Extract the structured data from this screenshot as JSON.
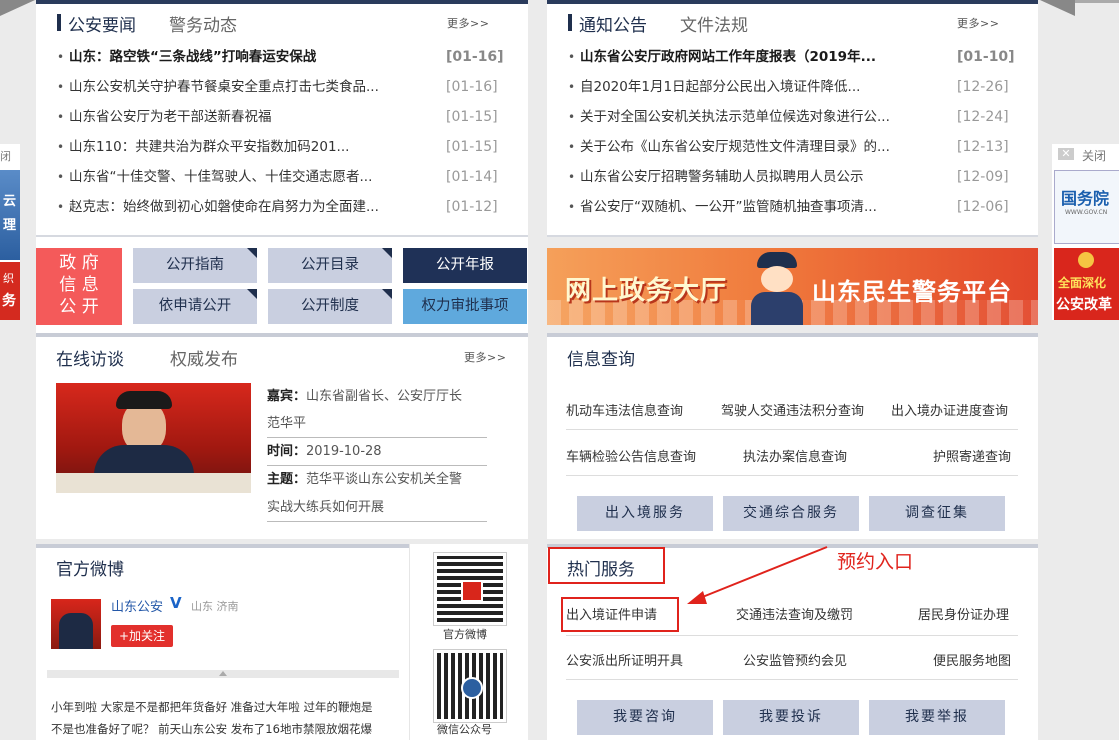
{
  "news_panel": {
    "tab_active": "公安要闻",
    "tab_other": "警务动态",
    "more": "更多>>",
    "items": [
      {
        "title": "山东：路空铁“三条战线”打响春运安保战",
        "date": "[01-16]"
      },
      {
        "title": "山东公安机关守护春节餐桌安全重点打击七类食品...",
        "date": "[01-16]"
      },
      {
        "title": "山东省公安厅为老干部送新春祝福",
        "date": "[01-15]"
      },
      {
        "title": "山东110：共建共治为群众平安指数加码201...",
        "date": "[01-15]"
      },
      {
        "title": "山东省“十佳交警、十佳驾驶人、十佳交通志愿者...",
        "date": "[01-14]"
      },
      {
        "title": "赵克志：始终做到初心如磐使命在肩努力为全面建...",
        "date": "[01-12]"
      }
    ]
  },
  "notice_panel": {
    "tab_active": "通知公告",
    "tab_other": "文件法规",
    "more": "更多>>",
    "items": [
      {
        "title": "山东省公安厅政府网站工作年度报表（2019年...",
        "date": "[01-10]"
      },
      {
        "title": "自2020年1月1日起部分公民出入境证件降低...",
        "date": "[12-26]"
      },
      {
        "title": "关于对全国公安机关执法示范单位候选对象进行公...",
        "date": "[12-24]"
      },
      {
        "title": "关于公布《山东省公安厅规范性文件清理目录》的...",
        "date": "[12-13]"
      },
      {
        "title": "山东省公安厅招聘警务辅助人员拟聘用人员公示",
        "date": "[12-09]"
      },
      {
        "title": "省公安厅“双随机、一公开”监管随机抽查事项清...",
        "date": "[12-06]"
      }
    ]
  },
  "gov_info": {
    "label_lines": [
      "政 府",
      "信 息",
      "公 开"
    ],
    "buttons": [
      "公开指南",
      "公开目录",
      "公开年报",
      "依申请公开",
      "公开制度",
      "权力审批事项"
    ]
  },
  "banner": {
    "left_text": "网上政务大厅",
    "right_text": "山东民生警务平台"
  },
  "interview": {
    "tab_active": "在线访谈",
    "tab_other": "权威发布",
    "more": "更多>>",
    "guest_label": "嘉宾：",
    "guest_value": "山东省副省长、公安厅厅长",
    "guest_name": "范华平",
    "time_label": "时间：",
    "time_value": "2019-10-28",
    "topic_label": "主题：",
    "topic_value": "范华平谈山东公安机关全警",
    "topic_value2": "实战大练兵如何开展"
  },
  "info_query": {
    "title": "信息查询",
    "links": [
      "机动车违法信息查询",
      "驾驶人交通违法积分查询",
      "出入境办证进度查询",
      "车辆检验公告信息查询",
      "执法办案信息查询",
      "护照寄递查询"
    ],
    "buttons": [
      "出入境服务",
      "交通综合服务",
      "调查征集"
    ]
  },
  "weibo": {
    "title": "官方微博",
    "account": "山东公安",
    "verified": "V",
    "location": "山东 济南",
    "follow": "+加关注",
    "post_line1": "小年到啦 大家是不是都把年货备好 准备过大年啦 过年的鞭炮是",
    "post_line2": "不是也准备好了呢？ 前天山东公安 发布了16地市禁限放烟花爆",
    "qr1_label": "官方微博",
    "qr2_label": "微信公众号"
  },
  "hot_services": {
    "title": "热门服务",
    "annotation": "预约入口",
    "links": [
      "出入境证件申请",
      "交通违法查询及缴罚",
      "居民身份证办理",
      "公安派出所证明开具",
      "公安监管预约会见",
      "便民服务地图"
    ],
    "buttons": [
      "我要咨询",
      "我要投诉",
      "我要举报"
    ]
  },
  "side_ads": {
    "close": "关闭",
    "left_close": "闭",
    "left_texts": [
      "云",
      "理",
      "织",
      "务"
    ],
    "right_top": "国务院",
    "right_top_sub": "WWW.GOV.CN",
    "right_bottom_1": "全面深化",
    "right_bottom_2": "公安改革"
  },
  "colors": {
    "navy": "#1f2f4d",
    "gray_button": "#c9cfe0",
    "annotation_red": "#e0231c",
    "gov_red": "#f45a5a"
  }
}
